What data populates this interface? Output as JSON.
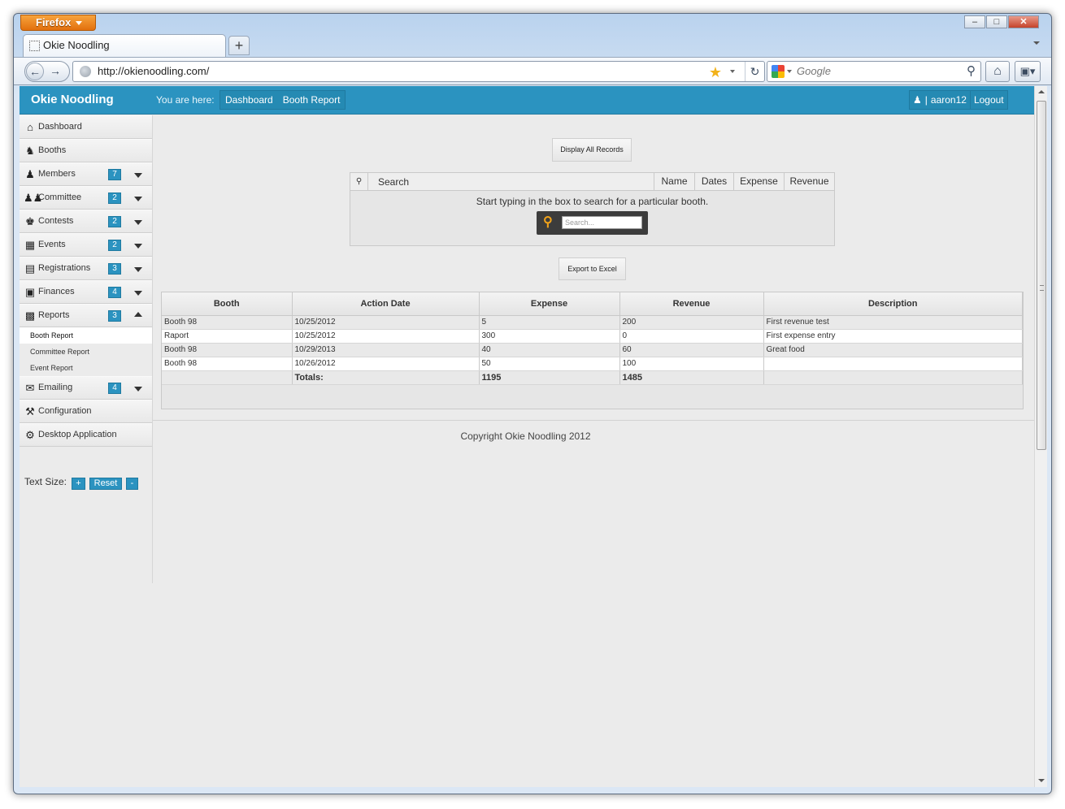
{
  "browser": {
    "app_button": "Firefox",
    "tab_title": "Okie Noodling",
    "new_tab": "+",
    "url": "http://okienoodling.com/",
    "search_placeholder": "Google"
  },
  "header": {
    "brand": "Okie Noodling",
    "you_are_here": "You are here:",
    "breadcrumbs": [
      "Dashboard",
      "Booth Report"
    ],
    "user_icon_sep": "|",
    "username": "aaron12",
    "logout": "Logout"
  },
  "sidebar": {
    "items": [
      {
        "label": "Dashboard",
        "icon": "home-icon",
        "badge": ""
      },
      {
        "label": "Booths",
        "icon": "horse-icon",
        "badge": ""
      },
      {
        "label": "Members",
        "icon": "user-icon",
        "badge": "7"
      },
      {
        "label": "Committee",
        "icon": "group-icon",
        "badge": "2"
      },
      {
        "label": "Contests",
        "icon": "trophy-icon",
        "badge": "2"
      },
      {
        "label": "Events",
        "icon": "calendar-icon",
        "badge": "2"
      },
      {
        "label": "Registrations",
        "icon": "book-icon",
        "badge": "3"
      },
      {
        "label": "Finances",
        "icon": "money-icon",
        "badge": "4"
      },
      {
        "label": "Reports",
        "icon": "bar-chart-icon",
        "badge": "3"
      }
    ],
    "sub_items": [
      "Booth Report",
      "Committee Report",
      "Event Report"
    ],
    "items_after": [
      {
        "label": "Emailing",
        "icon": "envelope-icon",
        "badge": "4"
      },
      {
        "label": "Configuration",
        "icon": "wrench-icon",
        "badge": ""
      },
      {
        "label": "Desktop Application",
        "icon": "gears-icon",
        "badge": ""
      }
    ],
    "text_size": {
      "label": "Text Size:",
      "plus": "+",
      "reset": "Reset",
      "minus": "-"
    }
  },
  "main": {
    "display_all": "Display All Records",
    "search": {
      "label": "Search",
      "columns": [
        "Name",
        "Dates",
        "Expense",
        "Revenue"
      ],
      "message": "Start typing in the box to search for a particular booth.",
      "placeholder": "Search..."
    },
    "export": "Export to Excel",
    "table": {
      "headers": [
        "Booth",
        "Action Date",
        "Expense",
        "Revenue",
        "Description"
      ],
      "rows": [
        [
          "Booth 98",
          "10/25/2012",
          "5",
          "200",
          "First revenue test"
        ],
        [
          "Raport",
          "10/25/2012",
          "300",
          "0",
          "First expense entry"
        ],
        [
          "Booth 98",
          "10/29/2013",
          "40",
          "60",
          "Great food"
        ],
        [
          "Booth 98",
          "10/26/2012",
          "50",
          "100",
          ""
        ]
      ],
      "totals_label": "Totals:",
      "total_expense": "1195",
      "total_revenue": "1485"
    },
    "copyright": "Copyright Okie Noodling  2012"
  }
}
